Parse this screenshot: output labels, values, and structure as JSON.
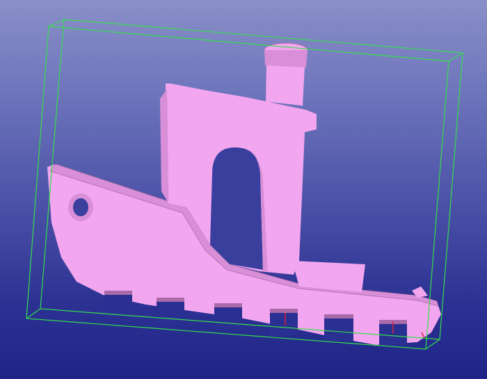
{
  "viewer": {
    "background_top": "#8a8fc8",
    "background_bottom": "#1f2488",
    "model_color": "#f2a6ef",
    "model_shade": "#d98fd8",
    "model_dark": "#a86aa8",
    "bbox_color": "#33e04a",
    "marker_color": "#e0203a"
  },
  "model": {
    "icon": "boat-model-icon",
    "bbox_icon": "bounding-box-icon"
  }
}
